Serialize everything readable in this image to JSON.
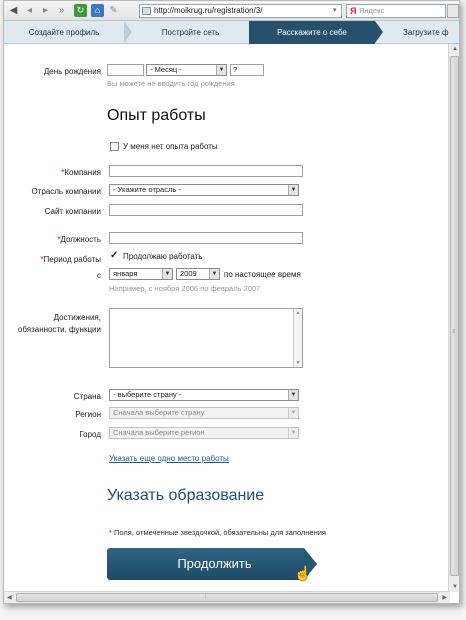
{
  "browser": {
    "url": "http://moikrug.ru/registration/3/",
    "search_placeholder": "Яндекс",
    "search_engine_glyph": "Я"
  },
  "steps": [
    {
      "label": "Создайте профиль",
      "active": false
    },
    {
      "label": "Постройте сеть",
      "active": false
    },
    {
      "label": "Расскажите о себе",
      "active": true
    },
    {
      "label": "Загрузите ф",
      "active": false
    }
  ],
  "birthday": {
    "label": "День рождения",
    "day_value": "",
    "month_value": "- Месяц -",
    "year_value": "?",
    "hint": "Вы можете не вводить год рождения"
  },
  "work": {
    "heading": "Опыт работы",
    "no_experience_label": "У меня нет опыта работы",
    "no_experience_checked": false,
    "company_label": "Компания",
    "industry_label": "Отрасль компании",
    "industry_value": "- Укажите отрасль -",
    "website_label": "Сайт компании",
    "position_label": "Должность",
    "period_label": "Период работы",
    "still_working_label": "Продолжаю работать",
    "still_working_checked": true,
    "from_label": "с",
    "from_month": "января",
    "from_year": "2009",
    "to_present_label": "по настоящее время",
    "period_hint": "Например, с ноября 2006 по февраль 2007",
    "achievements_label": "Достижения, обязанности, функции",
    "country_label": "Страна",
    "country_value": "- выберите страну -",
    "region_label": "Регион",
    "region_value": "Сначала выберите страну",
    "city_label": "Город",
    "city_value": "Сначала выберите регион",
    "add_workplace_link": "Указать еще одно место работы"
  },
  "education_link": "Указать образование",
  "required_note": "Поля, отмеченные звездочкой, обязательны для заполнения",
  "required_mark": "*",
  "continue_label": "Продолжить",
  "colors": {
    "accent": "#27506c",
    "link": "#1f5a8c",
    "required": "#cc0000"
  }
}
